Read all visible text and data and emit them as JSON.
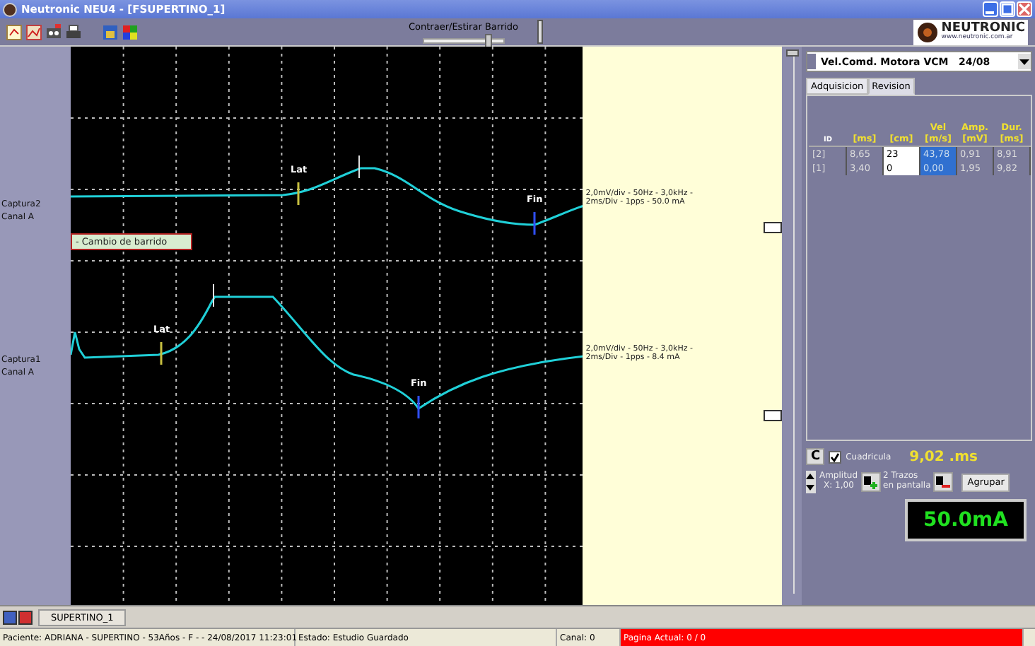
{
  "window": {
    "title": "Neutronic NEU4 - [FSUPERTINO_1]"
  },
  "toolbar": {
    "slider": {
      "label": "Contraer/Estirar Barrido",
      "level": 0.8
    },
    "logo_text": "NEUTRONIC",
    "logo_url": "www.neutronic.com.ar"
  },
  "channels": [
    {
      "name": "Captura2",
      "channel": "Canal A",
      "info": [
        "2,0mV/div - 50Hz - 3,0kHz -",
        "2ms/Div - 1pps - 50.0 mA"
      ],
      "markers": [
        "Lat",
        "Fin"
      ]
    },
    {
      "name": "Captura1",
      "channel": "Canal A",
      "info": [
        "2,0mV/div - 50Hz - 3,0kHz -",
        "2ms/Div - 1pps - 8.4 mA"
      ],
      "markers": [
        "Lat",
        "Fin"
      ]
    }
  ],
  "popup": "- Cambio de barrido",
  "panel": {
    "dropdown": "Vel.Comd. Motora VCM   24/08",
    "tabs": [
      {
        "label": "Adquisicion",
        "selected": false
      },
      {
        "label": "Revision",
        "selected": true
      }
    ],
    "columns": [
      "ID",
      "[ms]",
      "[cm]",
      "Vel [m/s]",
      "Amp. [mV]",
      "Dur. [ms]"
    ],
    "rows": [
      [
        "[2]",
        "8,65",
        "23",
        "43,78",
        "0,91",
        "8,91"
      ],
      [
        "[1]",
        "3,40",
        "0",
        "0,00",
        "1,95",
        "9,82"
      ]
    ],
    "c_button": "C",
    "grid": {
      "label": "Cuadricula",
      "checked": true
    },
    "time": "9,02 .ms",
    "amplitude": [
      "Amplitud",
      "X: 1,00"
    ],
    "traces": [
      "2 Trazos",
      "en pantalla"
    ],
    "group_button": "Agrupar",
    "display": "50.0mA"
  },
  "doc_tab": "SUPERTINO_1",
  "status_bar": [
    "Paciente: ADRIANA - SUPERTINO - 53Años - F -  - 24/08/2017 11:23:01",
    "Estado: Estudio Guardado",
    "Canal: 0",
    "Pagina Actual: 0 / 0"
  ]
}
